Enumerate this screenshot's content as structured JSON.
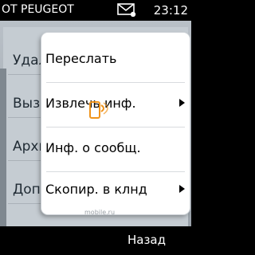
{
  "status_bar": {
    "title": "ОТ PEUGEOT",
    "time": "23:12",
    "icon": "envelope-icon"
  },
  "background_menu": {
    "items": [
      {
        "label": "Удалить"
      },
      {
        "label": "Вызов"
      },
      {
        "label": "Архив"
      },
      {
        "label": "Доп"
      }
    ]
  },
  "popup_menu": {
    "items": [
      {
        "label": "Переслать",
        "has_submenu": false
      },
      {
        "label": "Извлечь инф.",
        "has_submenu": true
      },
      {
        "label": "Инф. о сообщ.",
        "has_submenu": false
      },
      {
        "label": "Скопир. в клнд",
        "has_submenu": true
      }
    ]
  },
  "watermark": {
    "text": "mobile.ru"
  },
  "softkeys": {
    "right": "Назад"
  },
  "colors": {
    "accent": "#f0941c",
    "popup_bg": "#ffffff"
  }
}
